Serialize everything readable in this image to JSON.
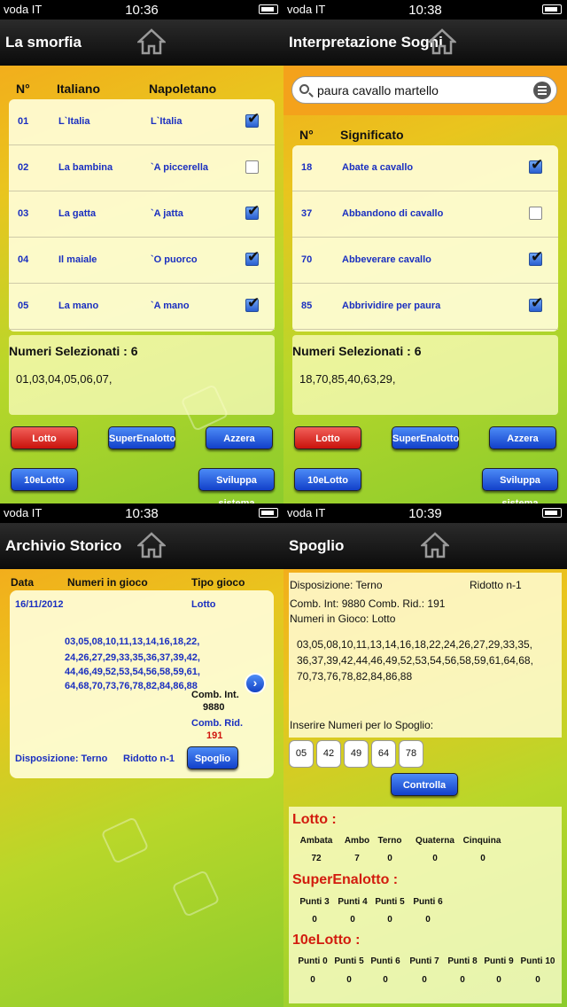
{
  "status": [
    {
      "carrier": "voda IT",
      "time": "10:36"
    },
    {
      "carrier": "voda IT",
      "time": "10:38"
    },
    {
      "carrier": "voda IT",
      "time": "10:38"
    },
    {
      "carrier": "voda IT",
      "time": "10:39"
    }
  ],
  "smorfia": {
    "title": "La smorfia",
    "headers": {
      "n": "N°",
      "it": "Italiano",
      "nap": "Napoletano"
    },
    "rows": [
      {
        "n": "01",
        "it": "L`Italia",
        "nap": "L`Italia",
        "checked": true
      },
      {
        "n": "02",
        "it": "La bambina",
        "nap": "`A piccerella",
        "checked": false
      },
      {
        "n": "03",
        "it": "La gatta",
        "nap": "`A jatta",
        "checked": true
      },
      {
        "n": "04",
        "it": "Il maiale",
        "nap": "`O puorco",
        "checked": true
      },
      {
        "n": "05",
        "it": "La mano",
        "nap": "`A mano",
        "checked": true
      }
    ],
    "selected_label": "Numeri Selezionati : 6",
    "selected_value": "01,03,04,05,06,07,",
    "buttons": {
      "lotto": "Lotto",
      "superenalotto": "SuperEnalotto",
      "azzera": "Azzera",
      "diecielotto": "10eLotto",
      "sviluppa": "Sviluppa sistema"
    }
  },
  "sogni": {
    "title": "Interpretazione Sogni",
    "search_query": "paura cavallo martello",
    "headers": {
      "n": "N°",
      "sig": "Significato"
    },
    "rows": [
      {
        "n": "18",
        "sig": "Abate a cavallo",
        "checked": true
      },
      {
        "n": "37",
        "sig": "Abbandono di cavallo",
        "checked": false
      },
      {
        "n": "70",
        "sig": "Abbeverare cavallo",
        "checked": true
      },
      {
        "n": "85",
        "sig": "Abbrividire per paura",
        "checked": true
      }
    ],
    "selected_label": "Numeri Selezionati : 6",
    "selected_value": "18,70,85,40,63,29,",
    "buttons": {
      "lotto": "Lotto",
      "superenalotto": "SuperEnalotto",
      "azzera": "Azzera",
      "diecielotto": "10eLotto",
      "sviluppa": "Sviluppa sistema"
    }
  },
  "archivio": {
    "title": "Archivio Storico",
    "headers": {
      "data": "Data",
      "numeri": "Numeri in gioco",
      "tipo": "Tipo gioco"
    },
    "date": "16/11/2012",
    "tipo": "Lotto",
    "numbers_lines": [
      "03,05,08,10,11,13,14,16,18,22,",
      "24,26,27,29,33,35,36,37,39,42,",
      "44,46,49,52,53,54,56,58,59,61,",
      "64,68,70,73,76,78,82,84,86,88"
    ],
    "comb_int_label": "Comb. Int.",
    "comb_int_value": "9880",
    "comb_rid_label": "Comb. Rid.",
    "comb_rid_value": "191",
    "disposizione": "Disposizione: Terno",
    "ridotto": "Ridotto n-1",
    "spoglio_button": "Spoglio"
  },
  "spoglio": {
    "title": "Spoglio",
    "disposizione": "Disposizione: Terno",
    "ridotto": "Ridotto n-1",
    "comb_line": "Comb. Int: 9880 Comb. Rid.: 191",
    "numeri_label": "Numeri in Gioco: Lotto",
    "numbers_lines": [
      "03,05,08,10,11,13,14,16,18,22,24,26,27,29,33,35,",
      "36,37,39,42,44,46,49,52,53,54,56,58,59,61,64,68,",
      "70,73,76,78,82,84,86,88"
    ],
    "inserire_label": "Inserire Numeri per lo Spoglio:",
    "inputs": [
      "05",
      "42",
      "49",
      "64",
      "78"
    ],
    "controlla_button": "Controlla",
    "lotto": {
      "heading": "Lotto :",
      "cols": [
        "Ambata",
        "Ambo",
        "Terno",
        "Quaterna",
        "Cinquina"
      ],
      "vals": [
        "72",
        "7",
        "0",
        "0",
        "0"
      ]
    },
    "superenalotto": {
      "heading": "SuperEnalotto :",
      "cols": [
        "Punti 3",
        "Punti 4",
        "Punti 5",
        "Punti 6"
      ],
      "vals": [
        "0",
        "0",
        "0",
        "0"
      ]
    },
    "diecielotto": {
      "heading": "10eLotto :",
      "cols": [
        "Punti 0",
        "Punti 5",
        "Punti 6",
        "Punti 7",
        "Punti 8",
        "Punti 9",
        "Punti 10"
      ],
      "vals": [
        "0",
        "0",
        "0",
        "0",
        "0",
        "0",
        "0"
      ]
    }
  }
}
